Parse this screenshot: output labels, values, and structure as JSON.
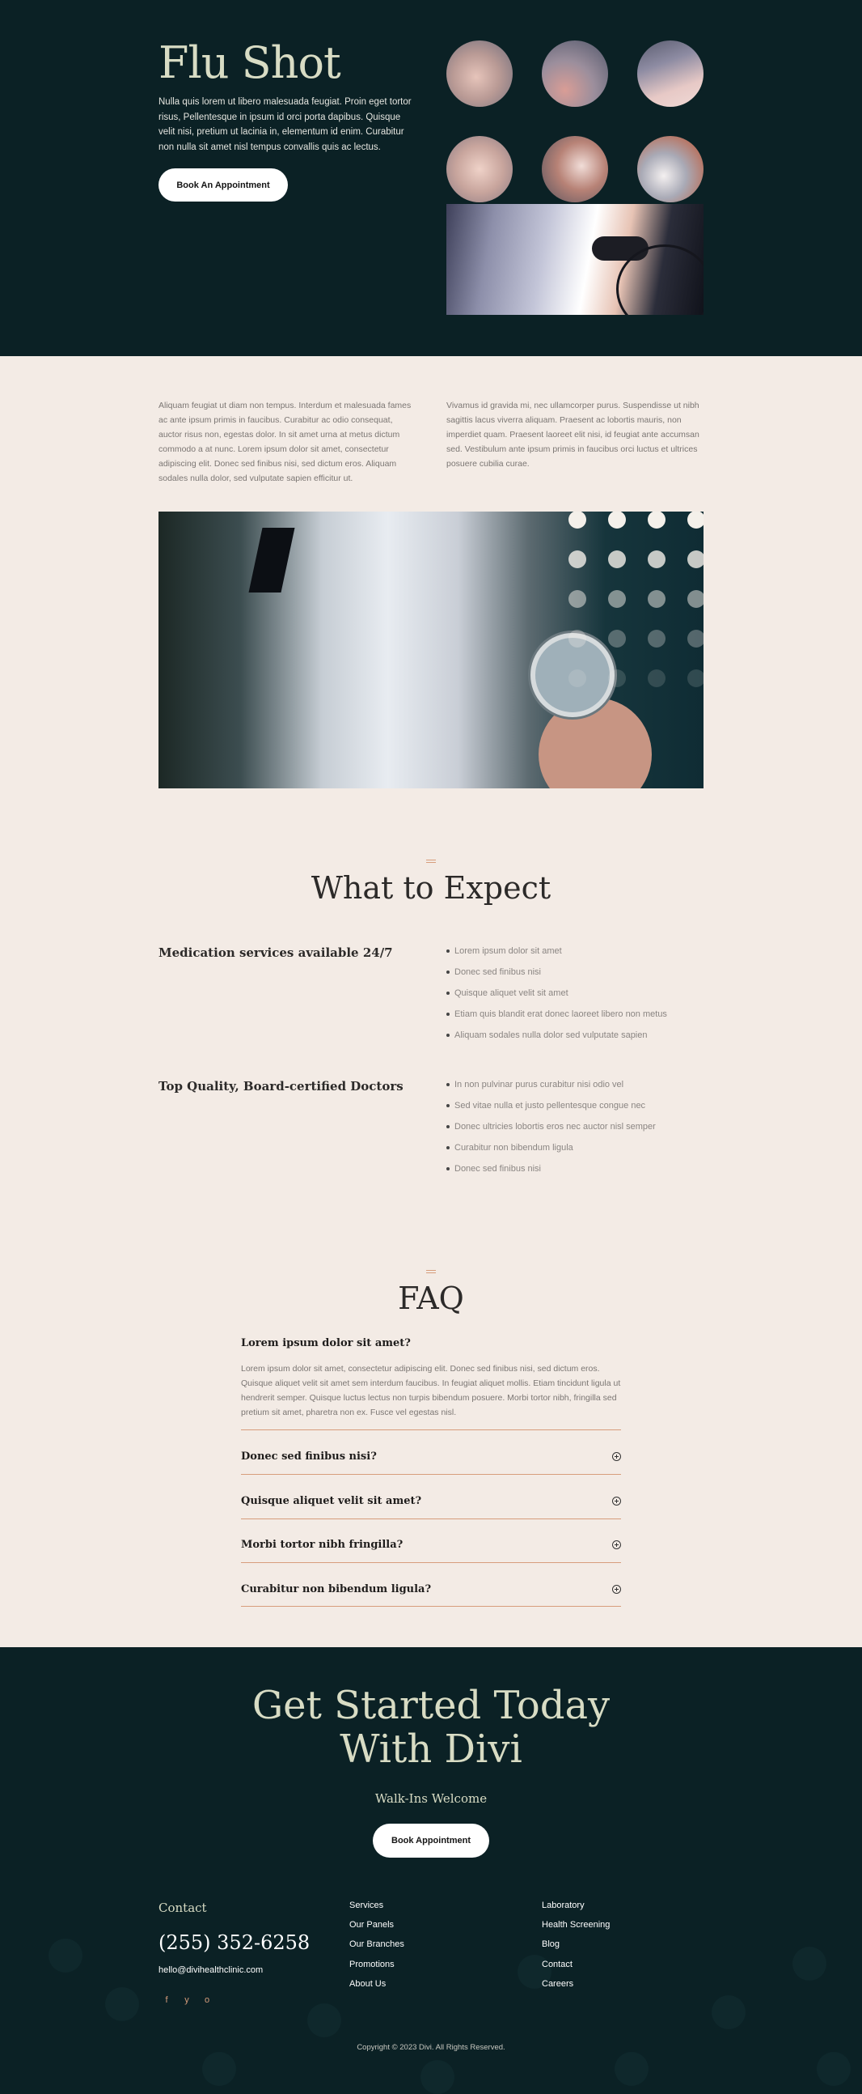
{
  "hero": {
    "title": "Flu Shot",
    "text": "Nulla quis lorem ut libero malesuada feugiat. Proin eget tortor risus, Pellentesque in ipsum id orci porta dapibus. Quisque velit nisi, pretium ut lacinia in, elementum id enim. Curabitur non nulla sit amet nisl tempus convallis quis ac lectus.",
    "button": "Book An Appointment"
  },
  "intro": {
    "col1": "Aliquam feugiat ut diam non tempus. Interdum et malesuada fames ac ante ipsum primis in faucibus. Curabitur ac odio consequat, auctor risus non, egestas dolor. In sit amet urna at metus dictum commodo a at nunc. Lorem ipsum dolor sit amet, consectetur adipiscing elit. Donec sed finibus nisi, sed dictum eros. Aliquam sodales nulla dolor, sed vulputate sapien efficitur ut.",
    "col2": "Vivamus id gravida mi, nec ullamcorper purus. Suspendisse ut nibh sagittis lacus viverra aliquam. Praesent ac lobortis mauris, non imperdiet quam. Praesent laoreet elit nisi, id feugiat ante accumsan sed. Vestibulum ante ipsum primis in faucibus orci luctus et ultrices posuere cubilia curae."
  },
  "expect": {
    "title": "What to Expect",
    "groups": [
      {
        "heading": "Medication services available 24/7",
        "items": [
          "Lorem ipsum dolor sit amet",
          "Donec sed finibus nisi",
          "Quisque aliquet velit sit amet",
          "Etiam quis blandit erat donec laoreet libero non metus",
          "Aliquam sodales nulla dolor sed vulputate sapien"
        ]
      },
      {
        "heading": "Top Quality, Board-certified Doctors",
        "items": [
          "In non pulvinar purus curabitur nisi odio vel",
          "Sed vitae nulla et justo pellentesque congue nec",
          "Donec ultricies lobortis eros nec auctor nisl semper",
          "Curabitur non bibendum ligula",
          "Donec sed finibus nisi"
        ]
      }
    ]
  },
  "faq": {
    "title": "FAQ",
    "open": {
      "question": "Lorem ipsum dolor sit amet?",
      "answer": "Lorem ipsum dolor sit amet, consectetur adipiscing elit. Donec sed finibus nisi, sed dictum eros. Quisque aliquet velit sit amet sem interdum faucibus. In feugiat aliquet mollis. Etiam tincidunt ligula ut hendrerit semper. Quisque luctus lectus non turpis bibendum posuere. Morbi tortor nibh, fringilla sed pretium sit amet, pharetra non ex. Fusce vel egestas nisl."
    },
    "items": [
      "Donec sed finibus nisi?",
      "Quisque aliquet velit sit amet?",
      "Morbi tortor nibh fringilla?",
      "Curabitur non bibendum ligula?"
    ]
  },
  "cta": {
    "title_line1": "Get Started Today",
    "title_line2": "With Divi",
    "subtitle": "Walk-Ins Welcome",
    "button": "Book Appointment"
  },
  "footer": {
    "contact_heading": "Contact",
    "phone": "(255) 352-6258",
    "email": "hello@divihealthclinic.com",
    "social": [
      "f",
      "y",
      "o"
    ],
    "social_icons": [
      "facebook-icon",
      "twitter-icon",
      "instagram-icon"
    ],
    "links_col1": [
      "Services",
      "Our Panels",
      "Our Branches",
      "Promotions",
      "About Us"
    ],
    "links_col2": [
      "Laboratory",
      "Health Screening",
      "Blog",
      "Contact",
      "Careers"
    ],
    "copyright": "Copyright © 2023 Divi. All Rights Reserved."
  },
  "colors": {
    "dark_bg": "#0b2125",
    "light_bg": "#f3ebe5",
    "accent": "#d79d7c",
    "heading_light": "#d8dcc4"
  }
}
